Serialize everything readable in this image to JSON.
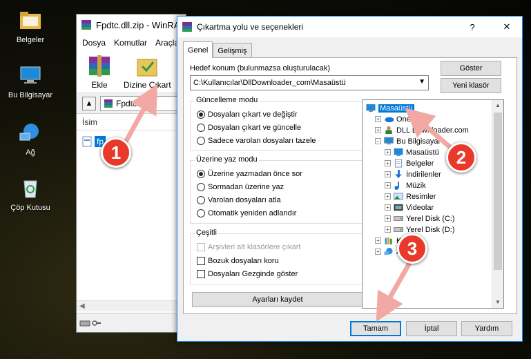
{
  "desktop": {
    "icons": [
      {
        "label": "Belgeler",
        "icon": "folder-icon"
      },
      {
        "label": "Bu Bilgisayar",
        "icon": "computer-icon"
      },
      {
        "label": "Ağ",
        "icon": "network-icon"
      },
      {
        "label": "Çöp Kutusu",
        "icon": "recycle-bin-icon"
      }
    ]
  },
  "winrar": {
    "title": "Fpdtc.dll.zip - WinRA",
    "menu": [
      "Dosya",
      "Komutlar",
      "Araçla"
    ],
    "toolbar": {
      "add_label": "Ekle",
      "extract_label": "Dizine Çıkart"
    },
    "path": "Fpdtc.dll.zi",
    "column_name": "İsim",
    "file_row": "fp"
  },
  "dialog": {
    "title": "Çıkartma yolu ve seçenekleri",
    "help_button": "?",
    "close_button": "✕",
    "tabs": [
      "Genel",
      "Gelişmiş"
    ],
    "destination_label": "Hedef konum (bulunmazsa oluşturulacak)",
    "destination_value": "C:\\Kullanıcılar\\DllDownloader_com\\Masaüstü",
    "show_button": "Göster",
    "new_folder_button": "Yeni klasör",
    "update_mode": {
      "title": "Güncelleme modu",
      "options": [
        "Dosyaları çıkart ve değiştir",
        "Dosyaları çıkart ve güncelle",
        "Sadece varolan dosyaları tazele"
      ],
      "selected": 0
    },
    "overwrite_mode": {
      "title": "Üzerine yaz modu",
      "options": [
        "Üzerine yazmadan önce sor",
        "Sormadan üzerine yaz",
        "Varolan dosyaları atla",
        "Otomatik yeniden adlandır"
      ],
      "selected": 0
    },
    "misc": {
      "title": "Çeşitli",
      "options": [
        {
          "label": "Arşivleri alt klasörlere çıkart",
          "disabled": true,
          "checked": false
        },
        {
          "label": "Bozuk dosyaları koru",
          "disabled": false,
          "checked": false
        },
        {
          "label": "Dosyaları Gezginde göster",
          "disabled": false,
          "checked": false
        }
      ]
    },
    "save_settings_button": "Ayarları kaydet",
    "tree": [
      {
        "label": "Masaüstü",
        "depth": 0,
        "expander": "",
        "selected": true,
        "icon": "desktop-icon"
      },
      {
        "label": "OneDr",
        "depth": 1,
        "expander": "+",
        "icon": "onedrive-icon"
      },
      {
        "label": "DLL Downloader.com",
        "depth": 1,
        "expander": "+",
        "icon": "user-icon"
      },
      {
        "label": "Bu Bilgisayar",
        "depth": 1,
        "expander": "−",
        "icon": "computer-icon"
      },
      {
        "label": "Masaüstü",
        "depth": 2,
        "expander": "+",
        "icon": "desktop-icon"
      },
      {
        "label": "Belgeler",
        "depth": 2,
        "expander": "+",
        "icon": "documents-icon"
      },
      {
        "label": "İndirilenler",
        "depth": 2,
        "expander": "+",
        "icon": "downloads-icon"
      },
      {
        "label": "Müzik",
        "depth": 2,
        "expander": "+",
        "icon": "music-icon"
      },
      {
        "label": "Resimler",
        "depth": 2,
        "expander": "+",
        "icon": "pictures-icon"
      },
      {
        "label": "Videolar",
        "depth": 2,
        "expander": "+",
        "icon": "videos-icon"
      },
      {
        "label": "Yerel Disk (C:)",
        "depth": 2,
        "expander": "+",
        "icon": "drive-icon"
      },
      {
        "label": "Yerel Disk (D:)",
        "depth": 2,
        "expander": "+",
        "icon": "drive-icon"
      },
      {
        "label": "Kita",
        "depth": 1,
        "expander": "+",
        "icon": "library-icon"
      },
      {
        "label": "Ağ",
        "depth": 1,
        "expander": "+",
        "icon": "network-icon"
      }
    ],
    "ok_button": "Tamam",
    "cancel_button": "İptal",
    "help_text_button": "Yardım"
  },
  "annotations": [
    "1",
    "2",
    "3"
  ],
  "colors": {
    "accent": "#0078d7",
    "marker": "#e8392b",
    "arrow": "#f3a9a3"
  }
}
